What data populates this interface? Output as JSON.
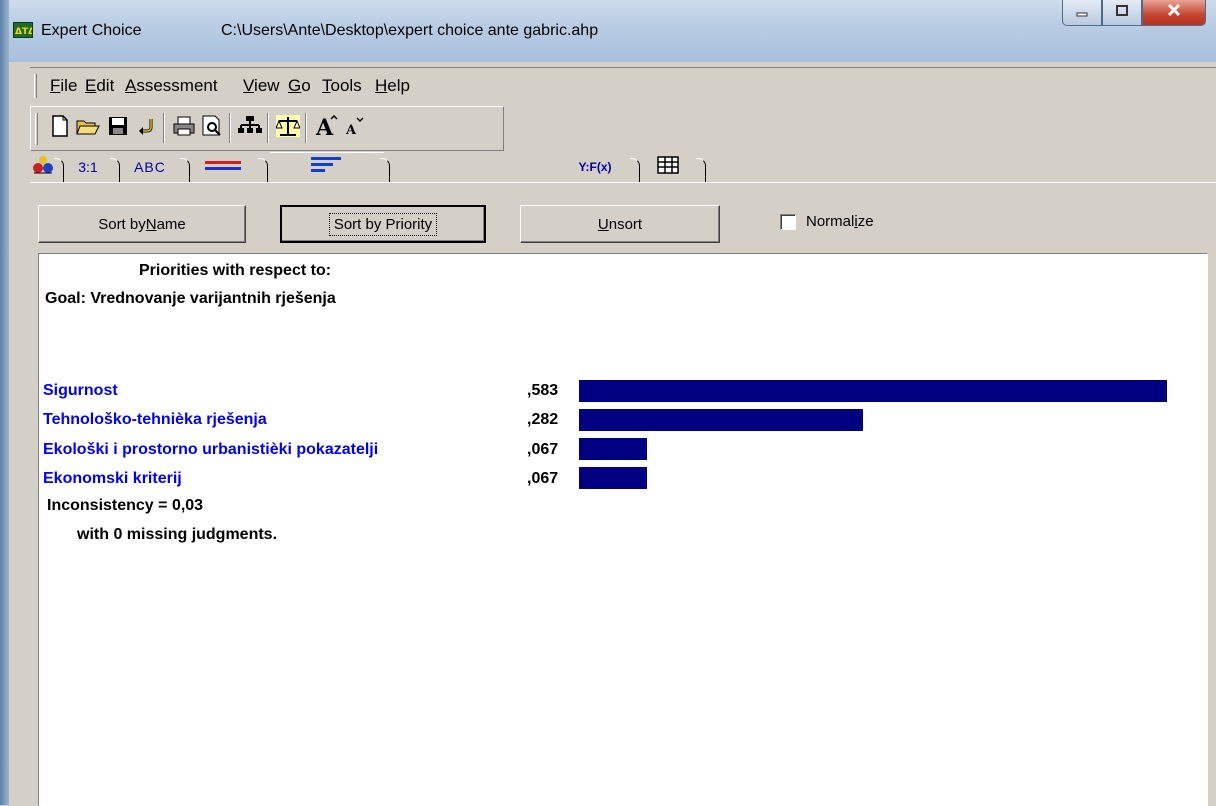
{
  "window": {
    "app_title": "Expert Choice",
    "file_path": "C:\\Users\\Ante\\Desktop\\expert choice ante gabric.ahp"
  },
  "menu": [
    {
      "label": "File",
      "u": "F",
      "rest": "ile"
    },
    {
      "label": "Edit",
      "u": "E",
      "rest": "dit"
    },
    {
      "label": "Assessment",
      "u": "A",
      "rest": "ssessment"
    },
    {
      "label": "View",
      "u": "V",
      "rest": "iew"
    },
    {
      "label": "Go",
      "u": "G",
      "rest": "o"
    },
    {
      "label": "Tools",
      "u": "T",
      "rest": "ools"
    },
    {
      "label": "Help",
      "u": "H",
      "rest": "elp"
    }
  ],
  "toolbar_icons": [
    "new-file-icon",
    "open-folder-icon",
    "save-icon",
    "undo-icon",
    "print-icon",
    "print-preview-icon",
    "hierarchy-icon",
    "assessment-scale-icon",
    "font-larger-icon",
    "font-smaller-icon"
  ],
  "tabs": {
    "ratio": "3:1",
    "text": "ABC",
    "formula": "Y:F(x)"
  },
  "buttons": {
    "sort_name_pre": "Sort by ",
    "sort_name_u": "N",
    "sort_name_post": "ame",
    "sort_priority": "Sort by Priority",
    "unsort_u": "U",
    "unsort_post": "nsort",
    "normalize_pre": "Normal",
    "normalize_u": "i",
    "normalize_post": "ze"
  },
  "report": {
    "heading": "Priorities with respect to:",
    "goal": "Goal: Vrednovanje varijantnih rješenja",
    "criteria": [
      {
        "name": "Sigurnost",
        "value": ",583",
        "priority": 0.583
      },
      {
        "name": "Tehnološko-tehnièka rješenja",
        "value": ",282",
        "priority": 0.282
      },
      {
        "name": "Ekološki i prostorno urbanistièki pokazatelji",
        "value": ",067",
        "priority": 0.067
      },
      {
        "name": "Ekonomski kriterij",
        "value": ",067",
        "priority": 0.067
      }
    ],
    "inconsistency": "Inconsistency = 0,03",
    "missing": "with 0  missing judgments."
  },
  "colors": {
    "bar": "#000080",
    "criterion_text": "#0000ff"
  }
}
